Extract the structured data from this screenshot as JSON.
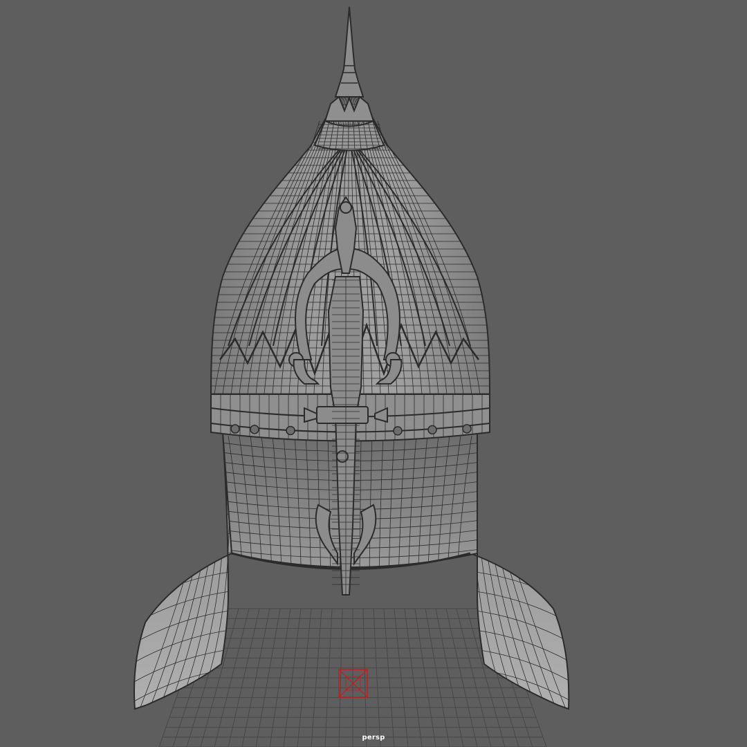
{
  "viewport": {
    "camera_name": "persp",
    "background_color": "#5e5e5e",
    "grid_color": "#474747",
    "model_fill_color": "#8a8a8a",
    "wireframe_color": "#2b2b2b",
    "pivot_color": "#d01818"
  },
  "model": {
    "icon": "helmet-wireframe-icon"
  }
}
